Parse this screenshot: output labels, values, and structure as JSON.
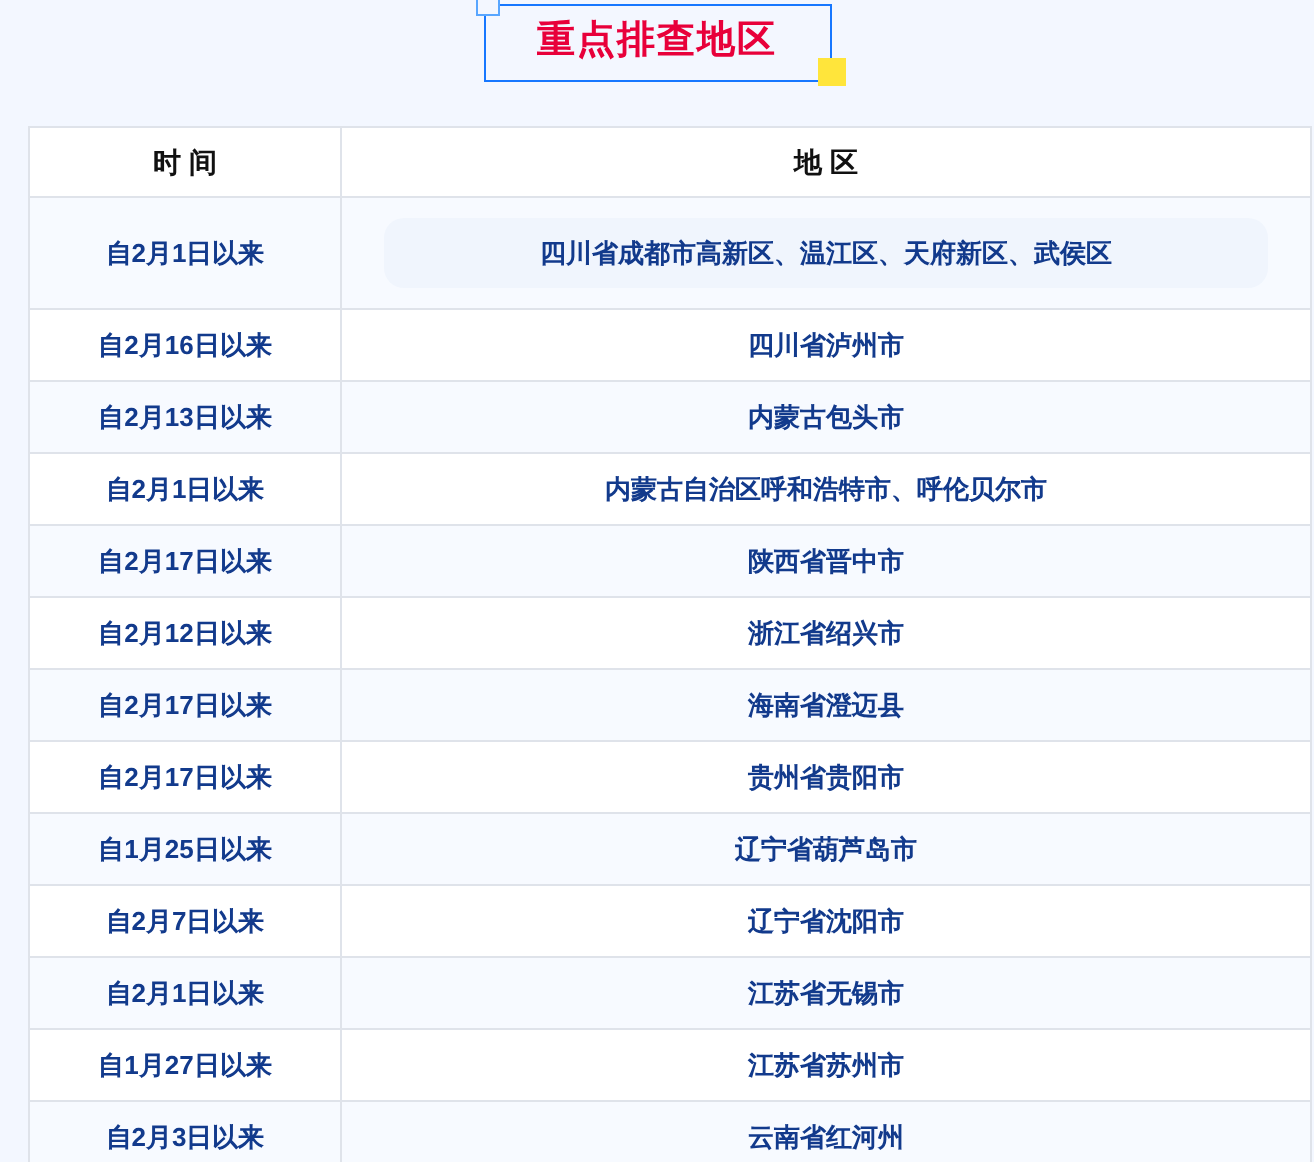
{
  "title": "重点排查地区",
  "table": {
    "columns": [
      "时 间",
      "地 区"
    ],
    "rows": [
      [
        "自2月1日以来",
        "四川省成都市高新区、温江区、天府新区、武侯区"
      ],
      [
        "自2月16日以来",
        "四川省泸州市"
      ],
      [
        "自2月13日以来",
        "内蒙古包头市"
      ],
      [
        "自2月1日以来",
        "内蒙古自治区呼和浩特市、呼伦贝尔市"
      ],
      [
        "自2月17日以来",
        "陕西省晋中市"
      ],
      [
        "自2月12日以来",
        "浙江省绍兴市"
      ],
      [
        "自2月17日以来",
        "海南省澄迈县"
      ],
      [
        "自2月17日以来",
        "贵州省贵阳市"
      ],
      [
        "自1月25日以来",
        "辽宁省葫芦岛市"
      ],
      [
        "自2月7日以来",
        "辽宁省沈阳市"
      ],
      [
        "自2月1日以来",
        "江苏省无锡市"
      ],
      [
        "自1月27日以来",
        "江苏省苏州市"
      ],
      [
        "自2月3日以来",
        "云南省红河州"
      ]
    ]
  }
}
